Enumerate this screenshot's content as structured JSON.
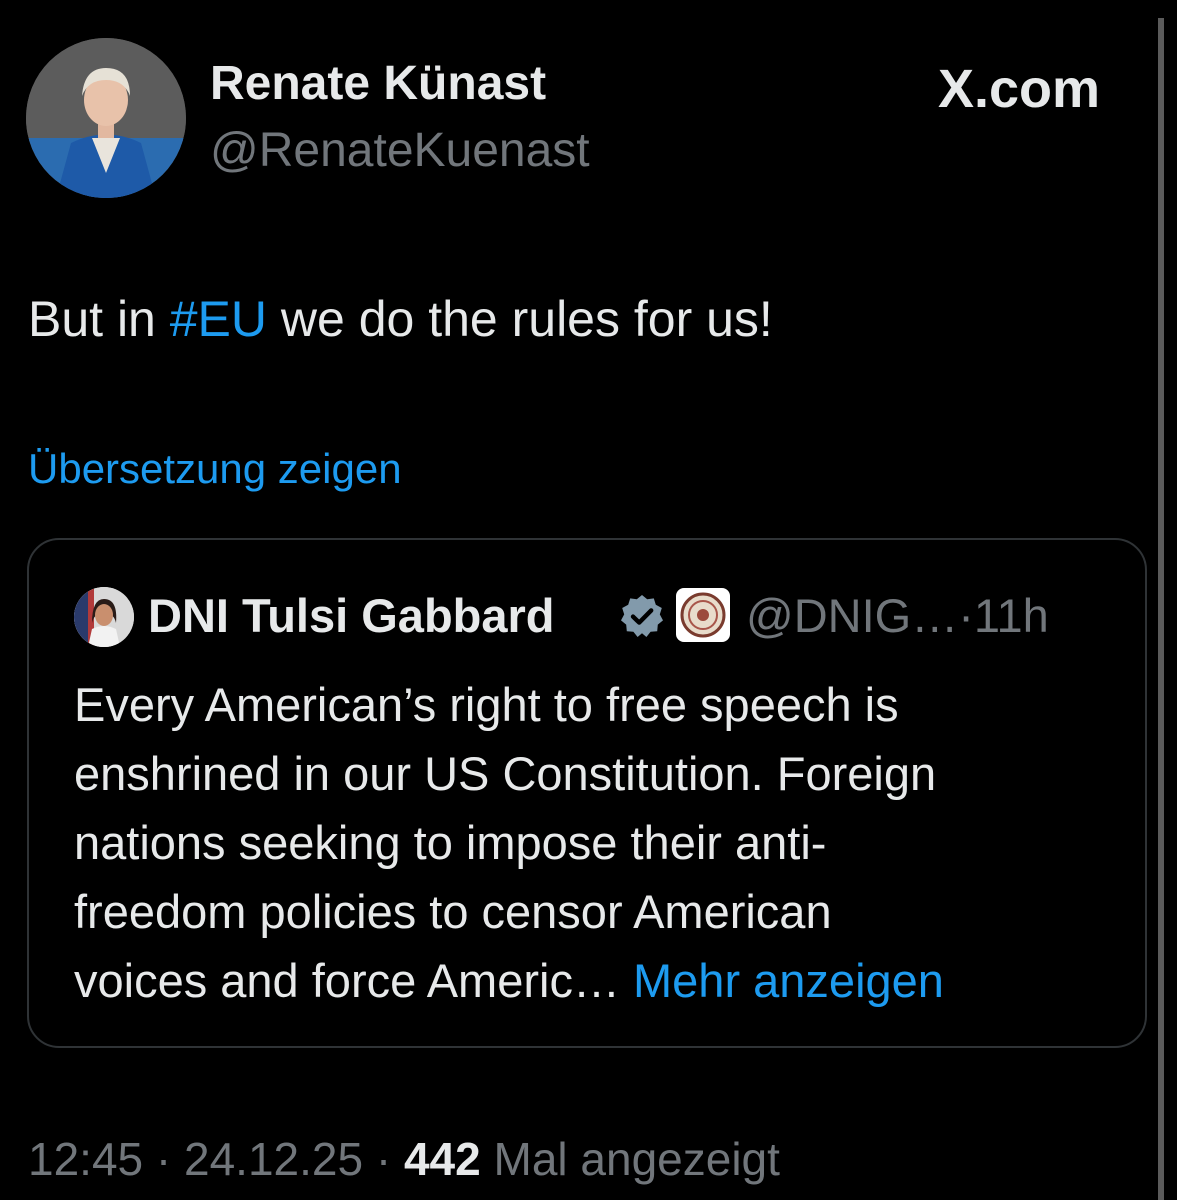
{
  "author": {
    "display_name": "Renate Künast",
    "handle": "@RenateKuenast"
  },
  "brand": "X.com",
  "tweet": {
    "text_before": "But in ",
    "hashtag": "#EU",
    "text_after": " we do the rules for us!",
    "translate_link": "Übersetzung zeigen"
  },
  "quoted": {
    "display_name": "DNI Tulsi Gabbard",
    "handle": "@DNIG…",
    "separator": "·",
    "age": "11h",
    "lines": [
      "Every American’s right to free speech is",
      "enshrined in our US Constitution. Foreign",
      "nations seeking to impose their anti-",
      "freedom policies to censor American"
    ],
    "last_line": "voices and force Americ…",
    "more_link": "Mehr anzeigen"
  },
  "meta": {
    "time": "12:45",
    "sep1": " · ",
    "date": "24.12.25",
    "sep2": " · ",
    "views": "442",
    "views_label": " Mal angezeigt"
  },
  "colors": {
    "background": "#000000",
    "text": "#e7e9ea",
    "muted": "#71767b",
    "link": "#1d9bf0",
    "border": "#2f3336",
    "verified": "#829aab"
  },
  "icons": [
    "verified-badge-icon",
    "affiliation-seal-icon"
  ]
}
